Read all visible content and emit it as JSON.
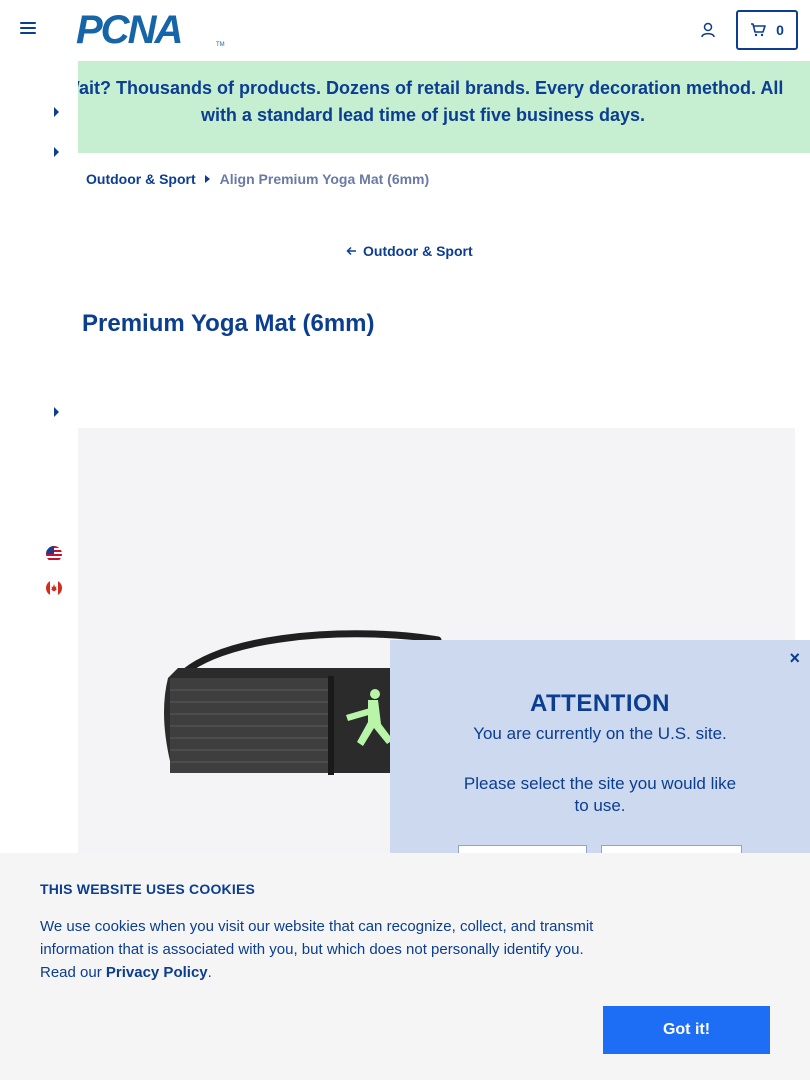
{
  "header": {
    "logo_text": "PCNA",
    "logo_tm": "TM",
    "cart_count": "0"
  },
  "promo": {
    "text": "Wait? Thousands of products. Dozens of retail brands. Every decoration method. All with a standard lead time of just five business days."
  },
  "breadcrumb": {
    "category": "Outdoor & Sport",
    "current": "Align Premium Yoga Mat (6mm)"
  },
  "back_link": {
    "label": "Outdoor & Sport"
  },
  "product": {
    "title": "Premium Yoga Mat (6mm)",
    "bag_color": "#2b2b2b",
    "accent_color": "#b8f5a8"
  },
  "modal": {
    "close": "×",
    "title": "ATTENTION",
    "subtitle": "You are currently on the U.S. site.",
    "prompt": "Please select the site you would like to use."
  },
  "cookie": {
    "title": "THIS WEBSITE USES COOKIES",
    "text": "We use cookies when you visit our website that can recognize, collect, and transmit information that is associated with you, but which does not personally identify you. Read our",
    "link": "Privacy Policy",
    "period": ".",
    "button": "Got it!"
  },
  "colors": {
    "brand": "#0b3d91",
    "promo_bg": "#c6efd1",
    "modal_bg": "#cdd9ef",
    "button": "#1d6ef5"
  },
  "icons": {
    "menu": "hamburger-icon",
    "account": "user-icon",
    "cart": "cart-icon",
    "back": "arrow-left-icon",
    "flag_us": "us-flag-icon",
    "flag_ca": "canada-flag-icon"
  }
}
